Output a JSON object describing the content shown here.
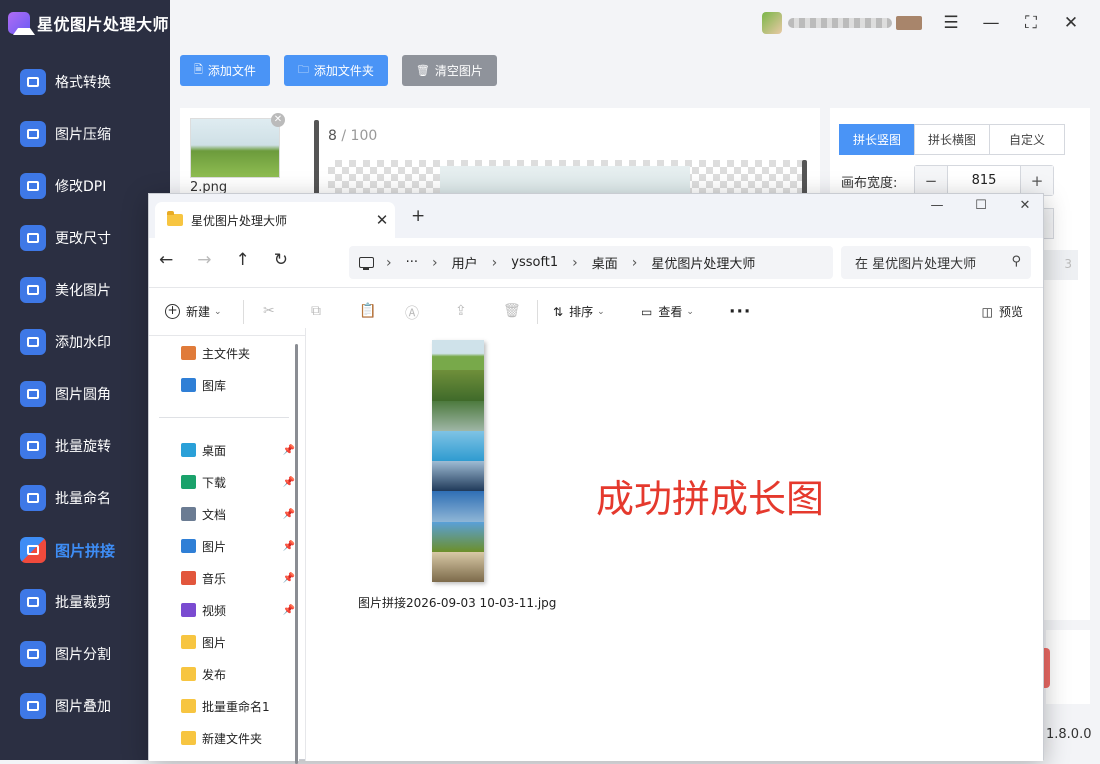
{
  "app": {
    "title": "星优图片处理大师",
    "version": "1.8.0.0",
    "nav": [
      {
        "label": "格式转换",
        "icon": "image-convert-icon"
      },
      {
        "label": "图片压缩",
        "icon": "image-compress-icon"
      },
      {
        "label": "修改DPI",
        "icon": "dpi-icon"
      },
      {
        "label": "更改尺寸",
        "icon": "resize-icon"
      },
      {
        "label": "美化图片",
        "icon": "beautify-icon"
      },
      {
        "label": "添加水印",
        "icon": "watermark-icon"
      },
      {
        "label": "图片圆角",
        "icon": "round-corner-icon"
      },
      {
        "label": "批量旋转",
        "icon": "rotate-icon"
      },
      {
        "label": "批量命名",
        "icon": "rename-icon"
      },
      {
        "label": "图片拼接",
        "icon": "stitch-icon",
        "active": true
      },
      {
        "label": "批量裁剪",
        "icon": "crop-icon"
      },
      {
        "label": "图片分割",
        "icon": "split-icon"
      },
      {
        "label": "图片叠加",
        "icon": "overlay-icon"
      }
    ]
  },
  "toolbar": {
    "add_file": "添加文件",
    "add_folder": "添加文件夹",
    "clear": "清空图片"
  },
  "workspace": {
    "thumb_name": "2.png",
    "page_current": "8",
    "page_total": "100"
  },
  "settings": {
    "tabs": [
      "拼长竖图",
      "拼长横图",
      "自定义"
    ],
    "canvas_width_label": "画布宽度:",
    "canvas_width_value": "815",
    "partial_value": "3"
  },
  "explorer": {
    "tab_title": "星优图片处理大师",
    "breadcrumb": [
      "用户",
      "yssoft1",
      "桌面",
      "星优图片处理大师"
    ],
    "search_placeholder": "在 星优图片处理大师",
    "cmd": {
      "new": "新建",
      "sort": "排序",
      "view": "查看",
      "more": "···",
      "preview": "预览"
    },
    "quick_access": [
      {
        "label": "主文件夹",
        "color": "#e07b3a"
      },
      {
        "label": "图库",
        "color": "#2f7fd6"
      }
    ],
    "pinned": [
      {
        "label": "桌面",
        "color": "#2aa0d8",
        "pinned": true
      },
      {
        "label": "下载",
        "color": "#1aa26b",
        "pinned": true
      },
      {
        "label": "文档",
        "color": "#6b7c93",
        "pinned": true
      },
      {
        "label": "图片",
        "color": "#2f7fd6",
        "pinned": true
      },
      {
        "label": "音乐",
        "color": "#e2563c",
        "pinned": true
      },
      {
        "label": "视频",
        "color": "#7a4bd1",
        "pinned": true
      },
      {
        "label": "图片",
        "color": "#f7c541",
        "pinned": false
      },
      {
        "label": "发布",
        "color": "#f7c541",
        "pinned": false
      },
      {
        "label": "批量重命名1",
        "color": "#f7c541",
        "pinned": false
      },
      {
        "label": "新建文件夹",
        "color": "#f7c541",
        "pinned": false
      }
    ],
    "file": {
      "name": "图片拼接2026-09-03 10-03-11.jpg"
    },
    "annotation": "成功拼成长图"
  }
}
